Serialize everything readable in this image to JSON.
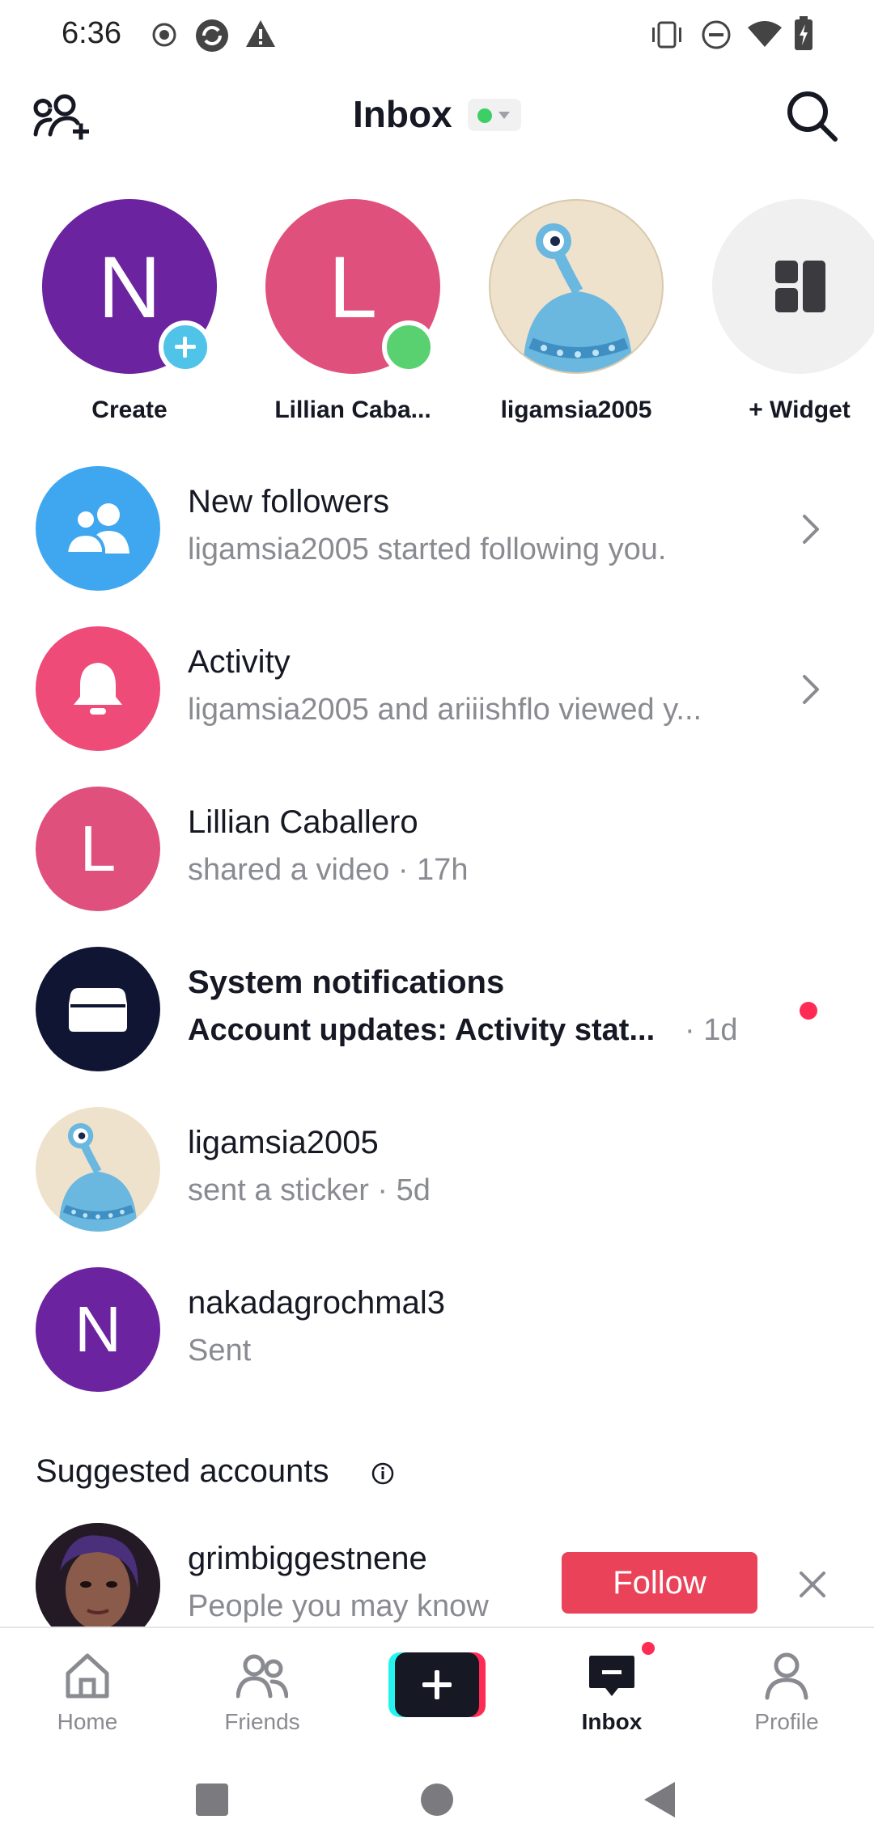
{
  "status_bar": {
    "time": "6:36"
  },
  "header": {
    "title": "Inbox",
    "status_color": "#3ccf66"
  },
  "stories": [
    {
      "label": "Create",
      "letter": "N",
      "color": "#6b23a0",
      "badge": "plus"
    },
    {
      "label": "Lillian Caba...",
      "letter": "L",
      "color": "#e0507d",
      "badge": "online"
    },
    {
      "label": "ligamsia2005",
      "letter": "",
      "color": "#efe2cc",
      "badge": ""
    },
    {
      "label": "+ Widget",
      "letter": "",
      "color": "#f0f0f1",
      "badge": ""
    }
  ],
  "list": [
    {
      "name": "New followers",
      "sub": "ligamsia2005 started following you.",
      "icon": "people-icon",
      "color": "#3fa7f0",
      "chevron": true
    },
    {
      "name": "Activity",
      "sub": "ligamsia2005 and ariiishflo viewed y...",
      "icon": "bell-icon",
      "color": "#ee4b78",
      "chevron": true
    },
    {
      "name": "Lillian Caballero",
      "sub": "shared a video · 17h",
      "letter": "L",
      "color": "#e0507d"
    },
    {
      "name": "System notifications",
      "sub": "Account updates: Activity stat...",
      "time": "· 1d",
      "icon": "inbox-tray-icon",
      "color": "#0f1533",
      "unread": true
    },
    {
      "name": "ligamsia2005",
      "sub": "sent a sticker · 5d",
      "icon": "alien-avatar",
      "color": "#efe2cc"
    },
    {
      "name": "nakadagrochmal3",
      "sub": "Sent",
      "letter": "N",
      "color": "#6b23a0"
    }
  ],
  "suggested": {
    "title": "Suggested accounts",
    "account": {
      "name": "grimbiggestnene",
      "sub": "People you may know",
      "follow_label": "Follow"
    }
  },
  "bottom_nav": [
    {
      "label": "Home",
      "icon": "home-icon"
    },
    {
      "label": "Friends",
      "icon": "friends-icon"
    },
    {
      "label": "",
      "icon": "create-icon"
    },
    {
      "label": "Inbox",
      "icon": "inbox-icon",
      "active": true
    },
    {
      "label": "Profile",
      "icon": "profile-icon"
    }
  ],
  "colors": {
    "accent": "#fe2c55",
    "follow": "#ea4359",
    "muted_text": "#8a8b91"
  }
}
